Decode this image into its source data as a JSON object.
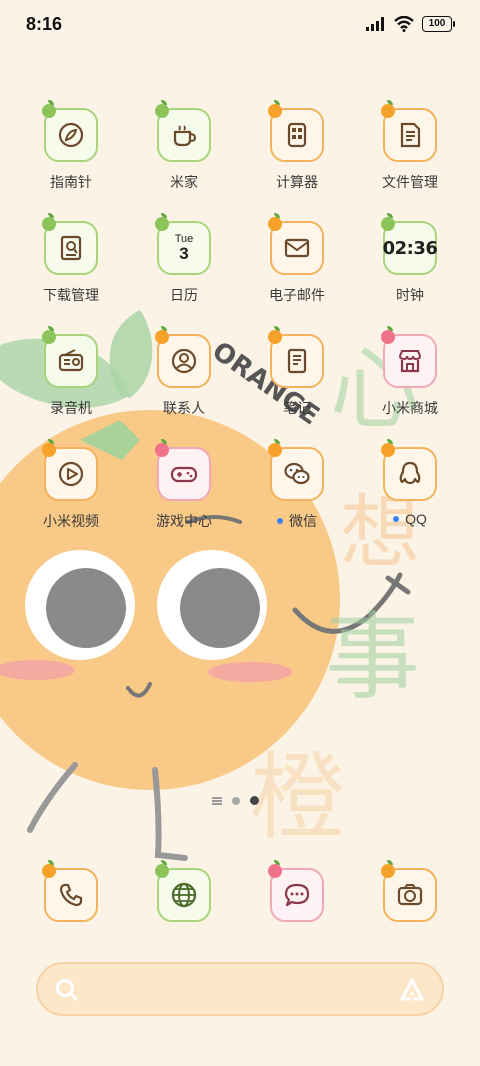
{
  "status": {
    "time": "8:16",
    "battery": "100"
  },
  "wallpaper": {
    "brand_text": "ORANGE",
    "slogan_chars": [
      "心",
      "想",
      "事",
      "橙"
    ]
  },
  "apps": [
    {
      "label": "指南针",
      "icon": "compass-icon",
      "theme": "green"
    },
    {
      "label": "米家",
      "icon": "cup-icon",
      "theme": "green"
    },
    {
      "label": "计算器",
      "icon": "calculator-icon",
      "theme": "orange"
    },
    {
      "label": "文件管理",
      "icon": "document-icon",
      "theme": "orange"
    },
    {
      "label": "下载管理",
      "icon": "download-icon",
      "theme": "green"
    },
    {
      "label": "日历",
      "icon": "calendar-icon",
      "theme": "green",
      "day": "Tue",
      "date": "3"
    },
    {
      "label": "电子邮件",
      "icon": "mail-icon",
      "theme": "orange"
    },
    {
      "label": "时钟",
      "icon": "clock-icon",
      "theme": "green",
      "time": "02:36"
    },
    {
      "label": "录音机",
      "icon": "radio-icon",
      "theme": "green"
    },
    {
      "label": "联系人",
      "icon": "contact-icon",
      "theme": "orange"
    },
    {
      "label": "笔记",
      "icon": "notes-icon",
      "theme": "orange"
    },
    {
      "label": "小米商城",
      "icon": "store-icon",
      "theme": "pink"
    },
    {
      "label": "小米视频",
      "icon": "play-icon",
      "theme": "orange"
    },
    {
      "label": "游戏中心",
      "icon": "gamepad-icon",
      "theme": "pink"
    },
    {
      "label": "微信",
      "icon": "wechat-icon",
      "theme": "orange",
      "badge": true
    },
    {
      "label": "QQ",
      "icon": "qq-icon",
      "theme": "orange",
      "badge": true
    }
  ],
  "dock": [
    {
      "icon": "phone-icon",
      "theme": "orange"
    },
    {
      "icon": "browser-icon",
      "theme": "green"
    },
    {
      "icon": "messages-icon",
      "theme": "pink"
    },
    {
      "icon": "camera-icon",
      "theme": "orange"
    }
  ],
  "page_indicator": {
    "pages": 2,
    "active": 2
  },
  "colors": {
    "background": "#fbf4e6",
    "orange": "#f6a22a",
    "green": "#8cc45a",
    "pink": "#f07288",
    "badge": "#3b82f6"
  }
}
